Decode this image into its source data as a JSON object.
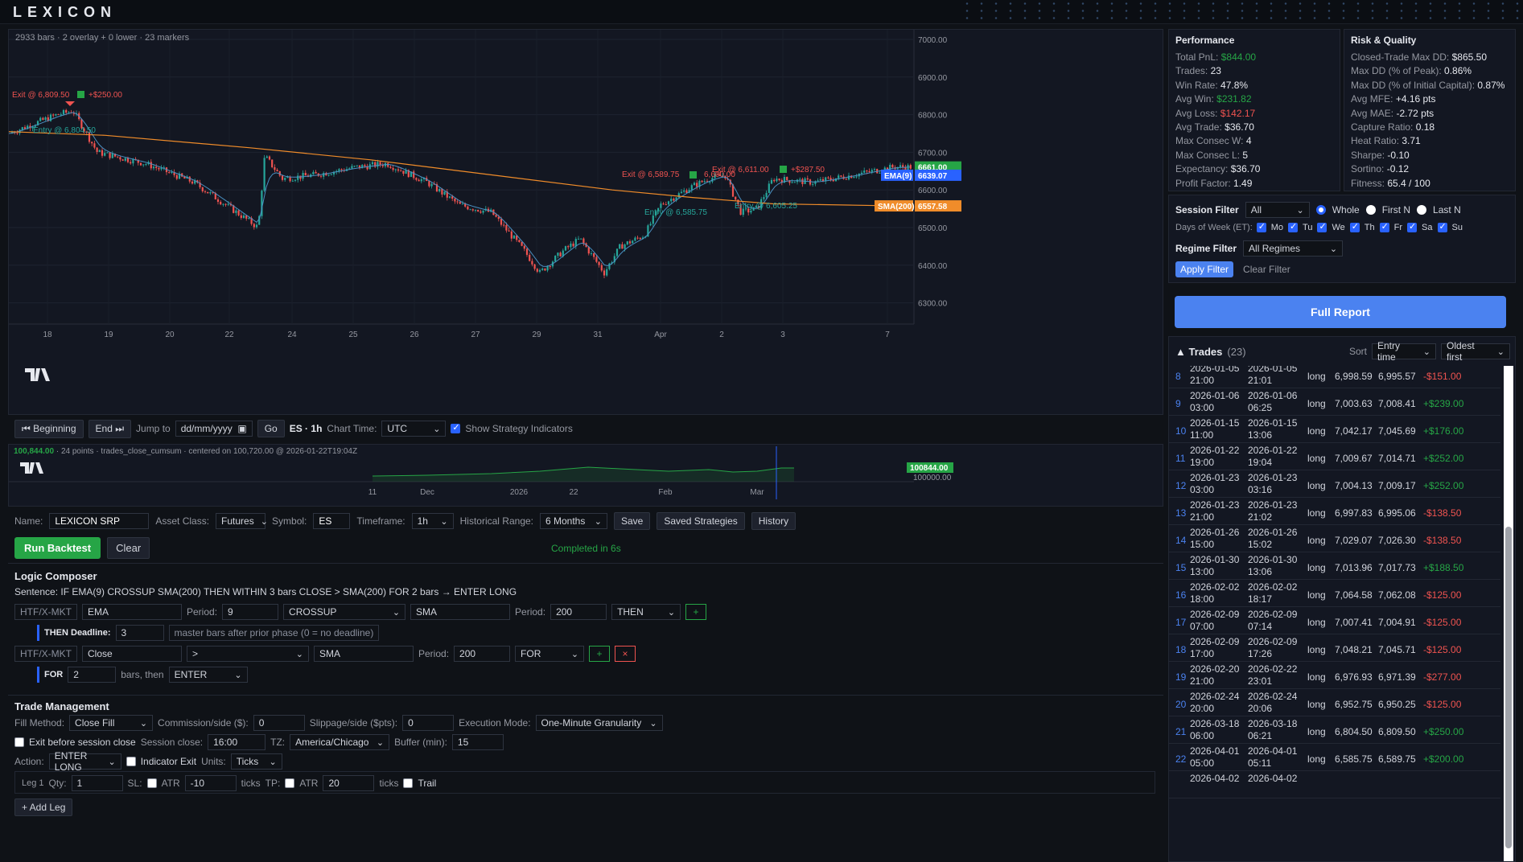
{
  "app": {
    "title": "LEXICON"
  },
  "chart": {
    "meta": "2933 bars · 2 overlay + 0 lower · 23 markers",
    "x_labels": [
      "18",
      "19",
      "20",
      "22",
      "24",
      "25",
      "26",
      "27",
      "29",
      "31",
      "Apr",
      "2",
      "3",
      "7"
    ],
    "y_labels": [
      "7000.00",
      "6900.00",
      "6800.00",
      "6700.00",
      "6600.00",
      "6500.00",
      "6400.00",
      "6300.00"
    ],
    "price_tags": {
      "last": "6661.00",
      "ema": "6639.07",
      "ema_label": "EMA(9)",
      "sma": "6557.58",
      "sma_label": "SMA(200)"
    },
    "markers": [
      {
        "text": "Exit @ 6,809.50",
        "pnl": "+$250.00"
      },
      {
        "text": "Entry @ 6,804.50"
      },
      {
        "text": "Exit @ 6,589.75"
      },
      {
        "text": "Entry @ 6,585.75"
      },
      {
        "text": "Exit @ 6,611.00",
        "pnl": "+$287.50"
      },
      {
        "text": "Entry @ 6,605.25"
      },
      {
        "text": "6,600.00"
      }
    ],
    "tv_logo": "TV"
  },
  "nav": {
    "beginning": "⏮ Beginning",
    "end": "End ⏭",
    "jump_label": "Jump to",
    "jump_placeholder": "dd/mm/yyyy",
    "go": "Go",
    "symbol_tf": "ES · 1h",
    "chart_time_label": "Chart Time:",
    "chart_time_value": "UTC",
    "show_indicators": "Show Strategy Indicators"
  },
  "mini": {
    "meta_value": "100,844.00",
    "meta_rest": "· 24 points · trades_close_cumsum · centered on 100,720.00 @ 2026-01-22T19:04Z",
    "x_labels": [
      "11",
      "Dec",
      "2026",
      "22",
      "Feb",
      "Mar"
    ],
    "tag_value": "100844.00",
    "axis_value": "100000.00"
  },
  "strategy": {
    "name_label": "Name:",
    "name_value": "LEXICON SRP",
    "asset_label": "Asset Class:",
    "asset_value": "Futures",
    "symbol_label": "Symbol:",
    "symbol_value": "ES",
    "tf_label": "Timeframe:",
    "tf_value": "1h",
    "range_label": "Historical Range:",
    "range_value": "6 Months",
    "save": "Save",
    "saved": "Saved Strategies",
    "history": "History",
    "run": "Run Backtest",
    "clear": "Clear",
    "status": "Completed in 6s"
  },
  "logic": {
    "title": "Logic Composer",
    "sentence": "Sentence: IF EMA(9) CROSSUP SMA(200) THEN WITHIN 3 bars CLOSE > SMA(200) FOR 2 bars → ENTER LONG",
    "row1": {
      "htf": "HTF/X-MKT",
      "ind": "EMA",
      "period_label": "Period:",
      "period": "9",
      "op": "CROSSUP",
      "ind2": "SMA",
      "period2_label": "Period:",
      "period2": "200",
      "join": "THEN",
      "add": "+"
    },
    "deadline": {
      "label": "THEN Deadline:",
      "value": "3",
      "hint": "master bars after prior phase (0 = no deadline)"
    },
    "row2": {
      "htf": "HTF/X-MKT",
      "ind": "Close",
      "op": ">",
      "ind2": "SMA",
      "period_label": "Period:",
      "period": "200",
      "join": "FOR",
      "add": "+",
      "remove": "×"
    },
    "for": {
      "label": "FOR",
      "value": "2",
      "hint": "bars, then",
      "action": "ENTER"
    }
  },
  "trade_mgmt": {
    "title": "Trade Management",
    "fill_label": "Fill Method:",
    "fill_value": "Close Fill",
    "comm_label": "Commission/side ($):",
    "comm_value": "0",
    "slip_label": "Slippage/side ($pts):",
    "slip_value": "0",
    "exec_label": "Execution Mode:",
    "exec_value": "One-Minute Granularity",
    "exit_session": "Exit before session close",
    "session_close_label": "Session close:",
    "session_close_value": "16:00",
    "tz_label": "TZ:",
    "tz_value": "America/Chicago",
    "buffer_label": "Buffer (min):",
    "buffer_value": "15",
    "action_label": "Action:",
    "action_value": "ENTER LONG",
    "indicator_exit": "Indicator Exit",
    "units_label": "Units:",
    "units_value": "Ticks",
    "leg_label": "Leg 1",
    "qty_label": "Qty:",
    "qty_value": "1",
    "sl_label": "SL:",
    "atr": "ATR",
    "sl_value": "-10",
    "ticks": "ticks",
    "tp_label": "TP:",
    "tp_value": "20",
    "trail": "Trail",
    "add_leg": "+ Add Leg"
  },
  "performance": {
    "title": "Performance",
    "items": [
      {
        "label": "Total PnL:",
        "value": "$844.00",
        "color": "green"
      },
      {
        "label": "Trades:",
        "value": "23"
      },
      {
        "label": "Win Rate:",
        "value": "47.8%"
      },
      {
        "label": "Avg Win:",
        "value": "$231.82",
        "color": "green"
      },
      {
        "label": "Avg Loss:",
        "value": "$142.17",
        "color": "red"
      },
      {
        "label": "Avg Trade:",
        "value": "$36.70"
      },
      {
        "label": "Max Consec W:",
        "value": "4"
      },
      {
        "label": "Max Consec L:",
        "value": "5"
      },
      {
        "label": "Expectancy:",
        "value": "$36.70"
      },
      {
        "label": "Profit Factor:",
        "value": "1.49"
      }
    ]
  },
  "risk": {
    "title": "Risk & Quality",
    "items": [
      {
        "label": "Closed-Trade Max DD:",
        "value": "$865.50"
      },
      {
        "label": "Max DD (% of Peak):",
        "value": "0.86%"
      },
      {
        "label": "Max DD (% of Initial Capital):",
        "value": "0.87%"
      },
      {
        "label": "Avg MFE:",
        "value": "+4.16 pts"
      },
      {
        "label": "Avg MAE:",
        "value": "-2.72 pts"
      },
      {
        "label": "Capture Ratio:",
        "value": "0.18"
      },
      {
        "label": "Heat Ratio:",
        "value": "3.71"
      },
      {
        "label": "Sharpe:",
        "value": "-0.10"
      },
      {
        "label": "Sortino:",
        "value": "-0.12"
      },
      {
        "label": "Fitness:",
        "value": "65.4 / 100"
      }
    ]
  },
  "filters": {
    "session_label": "Session Filter",
    "session_value": "All",
    "whole": "Whole",
    "first": "First N",
    "last": "Last N",
    "dow_label": "Days of Week (ET):",
    "days": [
      "Mo",
      "Tu",
      "We",
      "Th",
      "Fr",
      "Sa",
      "Su"
    ],
    "regime_label": "Regime Filter",
    "regime_value": "All Regimes",
    "apply": "Apply Filter",
    "clear": "Clear Filter"
  },
  "full_report": "Full Report",
  "trades": {
    "title": "▲ Trades",
    "count": "(23)",
    "sort_label": "Sort",
    "sort_value": "Entry time",
    "order_value": "Oldest first",
    "rows": [
      {
        "n": "8",
        "ed": "2026-01-05",
        "et": "21:00",
        "xd": "2026-01-05",
        "xt": "21:01",
        "side": "long",
        "ep": "6,998.59",
        "xp": "6,995.57",
        "pnl": "-$151.00",
        "win": false
      },
      {
        "n": "9",
        "ed": "2026-01-06",
        "et": "03:00",
        "xd": "2026-01-06",
        "xt": "06:25",
        "side": "long",
        "ep": "7,003.63",
        "xp": "7,008.41",
        "pnl": "+$239.00",
        "win": true
      },
      {
        "n": "10",
        "ed": "2026-01-15",
        "et": "11:00",
        "xd": "2026-01-15",
        "xt": "13:06",
        "side": "long",
        "ep": "7,042.17",
        "xp": "7,045.69",
        "pnl": "+$176.00",
        "win": true
      },
      {
        "n": "11",
        "ed": "2026-01-22",
        "et": "19:00",
        "xd": "2026-01-22",
        "xt": "19:04",
        "side": "long",
        "ep": "7,009.67",
        "xp": "7,014.71",
        "pnl": "+$252.00",
        "win": true
      },
      {
        "n": "12",
        "ed": "2026-01-23",
        "et": "03:00",
        "xd": "2026-01-23",
        "xt": "03:16",
        "side": "long",
        "ep": "7,004.13",
        "xp": "7,009.17",
        "pnl": "+$252.00",
        "win": true
      },
      {
        "n": "13",
        "ed": "2026-01-23",
        "et": "21:00",
        "xd": "2026-01-23",
        "xt": "21:02",
        "side": "long",
        "ep": "6,997.83",
        "xp": "6,995.06",
        "pnl": "-$138.50",
        "win": false
      },
      {
        "n": "14",
        "ed": "2026-01-26",
        "et": "15:00",
        "xd": "2026-01-26",
        "xt": "15:02",
        "side": "long",
        "ep": "7,029.07",
        "xp": "7,026.30",
        "pnl": "-$138.50",
        "win": false
      },
      {
        "n": "15",
        "ed": "2026-01-30",
        "et": "13:00",
        "xd": "2026-01-30",
        "xt": "13:06",
        "side": "long",
        "ep": "7,013.96",
        "xp": "7,017.73",
        "pnl": "+$188.50",
        "win": true
      },
      {
        "n": "16",
        "ed": "2026-02-02",
        "et": "18:00",
        "xd": "2026-02-02",
        "xt": "18:17",
        "side": "long",
        "ep": "7,064.58",
        "xp": "7,062.08",
        "pnl": "-$125.00",
        "win": false
      },
      {
        "n": "17",
        "ed": "2026-02-09",
        "et": "07:00",
        "xd": "2026-02-09",
        "xt": "07:14",
        "side": "long",
        "ep": "7,007.41",
        "xp": "7,004.91",
        "pnl": "-$125.00",
        "win": false
      },
      {
        "n": "18",
        "ed": "2026-02-09",
        "et": "17:00",
        "xd": "2026-02-09",
        "xt": "17:26",
        "side": "long",
        "ep": "7,048.21",
        "xp": "7,045.71",
        "pnl": "-$125.00",
        "win": false
      },
      {
        "n": "19",
        "ed": "2026-02-20",
        "et": "21:00",
        "xd": "2026-02-22",
        "xt": "23:01",
        "side": "long",
        "ep": "6,976.93",
        "xp": "6,971.39",
        "pnl": "-$277.00",
        "win": false
      },
      {
        "n": "20",
        "ed": "2026-02-24",
        "et": "20:00",
        "xd": "2026-02-24",
        "xt": "20:06",
        "side": "long",
        "ep": "6,952.75",
        "xp": "6,950.25",
        "pnl": "-$125.00",
        "win": false
      },
      {
        "n": "21",
        "ed": "2026-03-18",
        "et": "06:00",
        "xd": "2026-03-18",
        "xt": "06:21",
        "side": "long",
        "ep": "6,804.50",
        "xp": "6,809.50",
        "pnl": "+$250.00",
        "win": true
      },
      {
        "n": "22",
        "ed": "2026-04-01",
        "et": "05:00",
        "xd": "2026-04-01",
        "xt": "05:11",
        "side": "long",
        "ep": "6,585.75",
        "xp": "6,589.75",
        "pnl": "+$200.00",
        "win": true
      },
      {
        "n": "",
        "ed": "2026-04-02",
        "et": "",
        "xd": "2026-04-02",
        "xt": "",
        "side": "",
        "ep": "",
        "xp": "",
        "pnl": "",
        "win": true
      }
    ]
  }
}
